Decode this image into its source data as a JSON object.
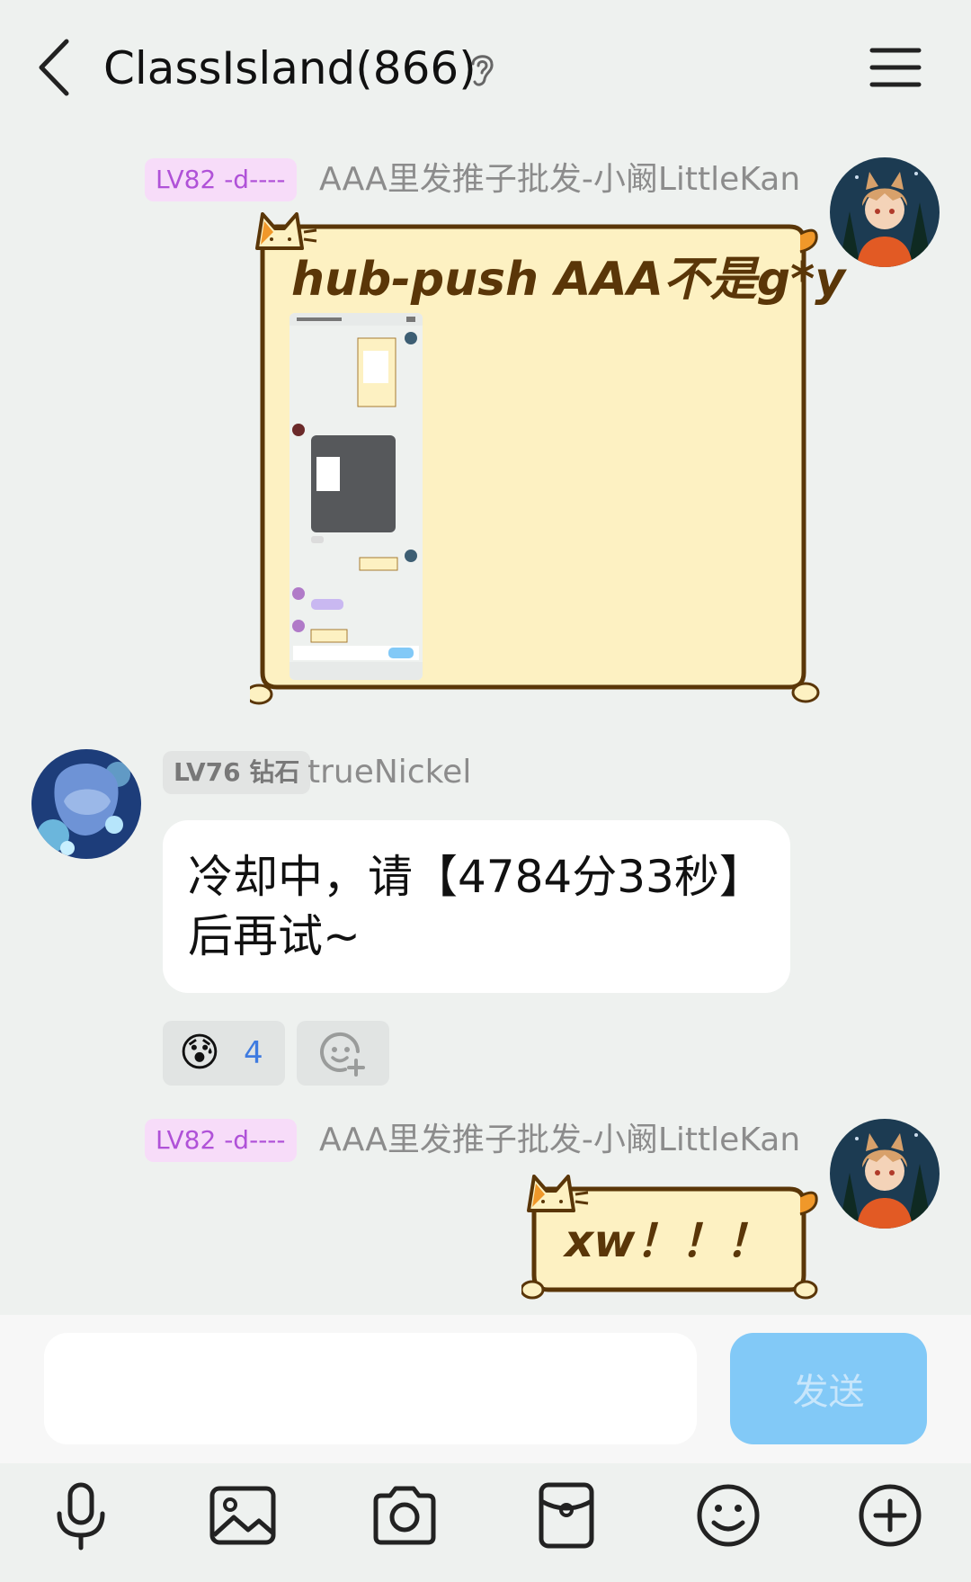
{
  "header": {
    "title": "ClassIsland(866)"
  },
  "messages": [
    {
      "level": "LV82 -d----",
      "sender": "AAA里发推子批发-小阚LittleKan",
      "text": "hub-push AAA不是g*y"
    },
    {
      "level": "LV76 钻石",
      "sender": "trueNickel",
      "text": "冷却中，请【4784分33秒】后再试~",
      "reaction": {
        "emoji": "😰",
        "count": "4"
      }
    },
    {
      "level": "LV82 -d----",
      "sender": "AAA里发推子批发-小阚LittleKan",
      "text": "xw！！！"
    }
  ],
  "composer": {
    "send_label": "发送",
    "placeholder": ""
  },
  "colors": {
    "accent": "#82c9f7",
    "level_badge": "#f7dcf9",
    "cat_bubble": "#fdf1c2"
  }
}
